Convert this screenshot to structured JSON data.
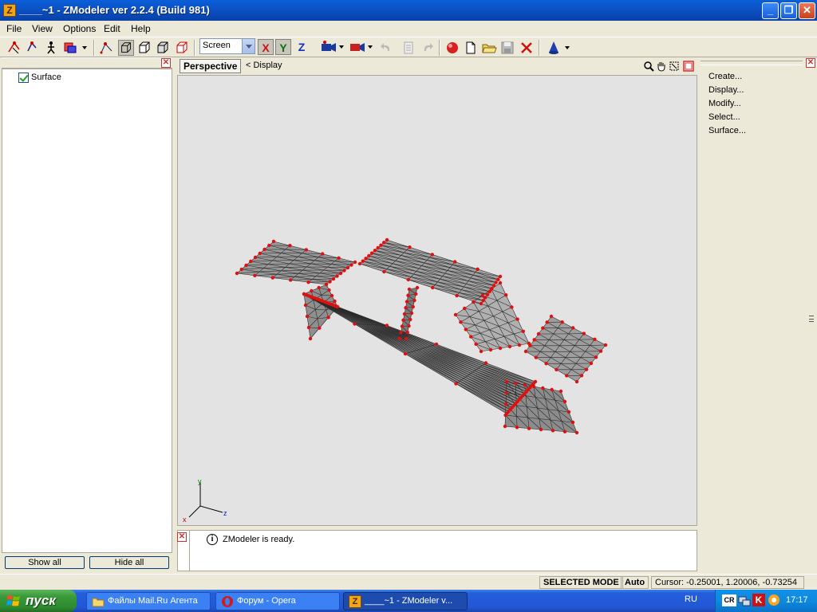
{
  "window": {
    "title": "____~1 - ZModeler ver 2.2.4 (Build 981)"
  },
  "menu": [
    {
      "label": "File",
      "accel": "F"
    },
    {
      "label": "View",
      "accel": "V"
    },
    {
      "label": "Options",
      "accel": "O"
    },
    {
      "label": "Edit",
      "accel": "E"
    },
    {
      "label": "Help",
      "accel": "H"
    }
  ],
  "toolbar": {
    "coord_mode": "Screen",
    "axes": [
      "X",
      "Y",
      "Z"
    ]
  },
  "left_panel": {
    "tree": [
      {
        "label": "Surface",
        "checked": true
      }
    ],
    "show_all": "Show all",
    "hide_all": "Hide all"
  },
  "viewport": {
    "tab": "Perspective",
    "display_link": "< Display",
    "axis_labels": {
      "x": "x",
      "y": "y",
      "z": "z"
    }
  },
  "right_panel": {
    "items": [
      "Create...",
      "Display...",
      "Modify...",
      "Select...",
      "Surface..."
    ]
  },
  "log": {
    "message": "ZModeler is ready."
  },
  "statusbar": {
    "mode": "SELECTED MODE",
    "auto": "Auto",
    "cursor": "Cursor: -0.25001, 1.20006, -0.73254"
  },
  "taskbar": {
    "start": "пуск",
    "tasks": [
      "Файлы Mail.Ru Агента",
      "Форум - Opera",
      "____~1 - ZModeler v..."
    ],
    "lang": "RU",
    "clock": "17:17"
  },
  "colors": {
    "vertex": "#e01010",
    "mesh": "#8e8e8e",
    "viewport_bg": "#e3e3e3"
  }
}
